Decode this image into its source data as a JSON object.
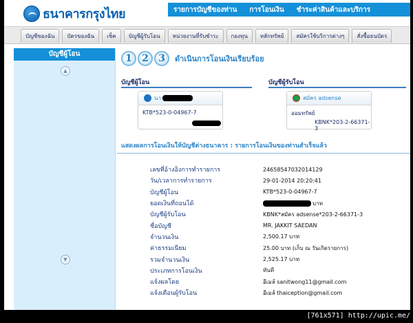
{
  "header": {
    "brand": "ธนาคารกรุงไทย",
    "topnav": [
      "รายการบัญชีของท่าน",
      "การโอนเงิน",
      "ชำระค่าสินค้าและบริการ"
    ]
  },
  "tabs": [
    "บัญชีของฉัน",
    "บัตรของฉัน",
    "เช็ค",
    "บัญชีผู้รับโอน",
    "หน่วยงานที่รับชำระ",
    "กองทุน",
    "หลักทรัพย์",
    "สมัครใช้บริการต่างๆ",
    "สั่งซื้อธนบัตร"
  ],
  "sidebar": {
    "title": "บัญชีผู้โอน",
    "scroll_up": "▲",
    "scroll_down": "▼"
  },
  "steps": {
    "items": [
      "1",
      "2",
      "3"
    ],
    "title": "ดำเนินการโอนเงินเรียบร้อย"
  },
  "from_section": {
    "label": "บัญชีผู้โอน",
    "name_prefix": "นา",
    "account": "KTB*523-0-04967-7"
  },
  "to_section": {
    "label": "บัญชีผู้รับโอน",
    "name": "สมัคร adsense",
    "type": "ออมทรัพย์",
    "account": "KBNK*203-2-66371-3"
  },
  "result": {
    "title": "แสดงผลการโอนเงินให้บัญชีต่างธนาคาร   :   รายการโอนเงินของท่านสำเร็จแล้ว"
  },
  "details": [
    {
      "label": "เลขที่อ้างอิงการทำรายการ",
      "value": "24658547032014129"
    },
    {
      "label": "วัน/เวลาการทำรายการ",
      "value": "29-01-2014 20:20:41"
    },
    {
      "label": "บัญชีผู้โอน",
      "value": "KTB*523-0-04967-7"
    },
    {
      "label": "ยอดเงินที่ถอนได้",
      "value": "บาท"
    },
    {
      "label": "บัญชีผู้รับโอน",
      "value": "KBNK*สมัคร adsense*203-2-66371-3"
    },
    {
      "label": "ชื่อบัญชี",
      "value": "MR. JAKKIT SAEDAN"
    },
    {
      "label": "จำนวนเงิน",
      "value": "2,500.17 บาท"
    },
    {
      "label": "ค่าธรรมเนียม",
      "value": "25.00 บาท (เก็บ ณ วันเกิดรายการ)"
    },
    {
      "label": "รวมจำนวนเงิน",
      "value": "2,525.17 บาท"
    },
    {
      "label": "ประเภทการโอนเงิน",
      "value": "ทันที"
    },
    {
      "label": "แจ้งผลโดย",
      "value": "อีเมล์  sanitwong11@gmail.com"
    },
    {
      "label": "แจ้งเตือนผู้รับโอน",
      "value": "อีเมล์ thaiception@gmail.com"
    }
  ],
  "watermark": "[761x571] http://upic.me/",
  "colors": {
    "accent": "#1490d8",
    "label": "#1d3d84",
    "title": "#2f84c6"
  }
}
